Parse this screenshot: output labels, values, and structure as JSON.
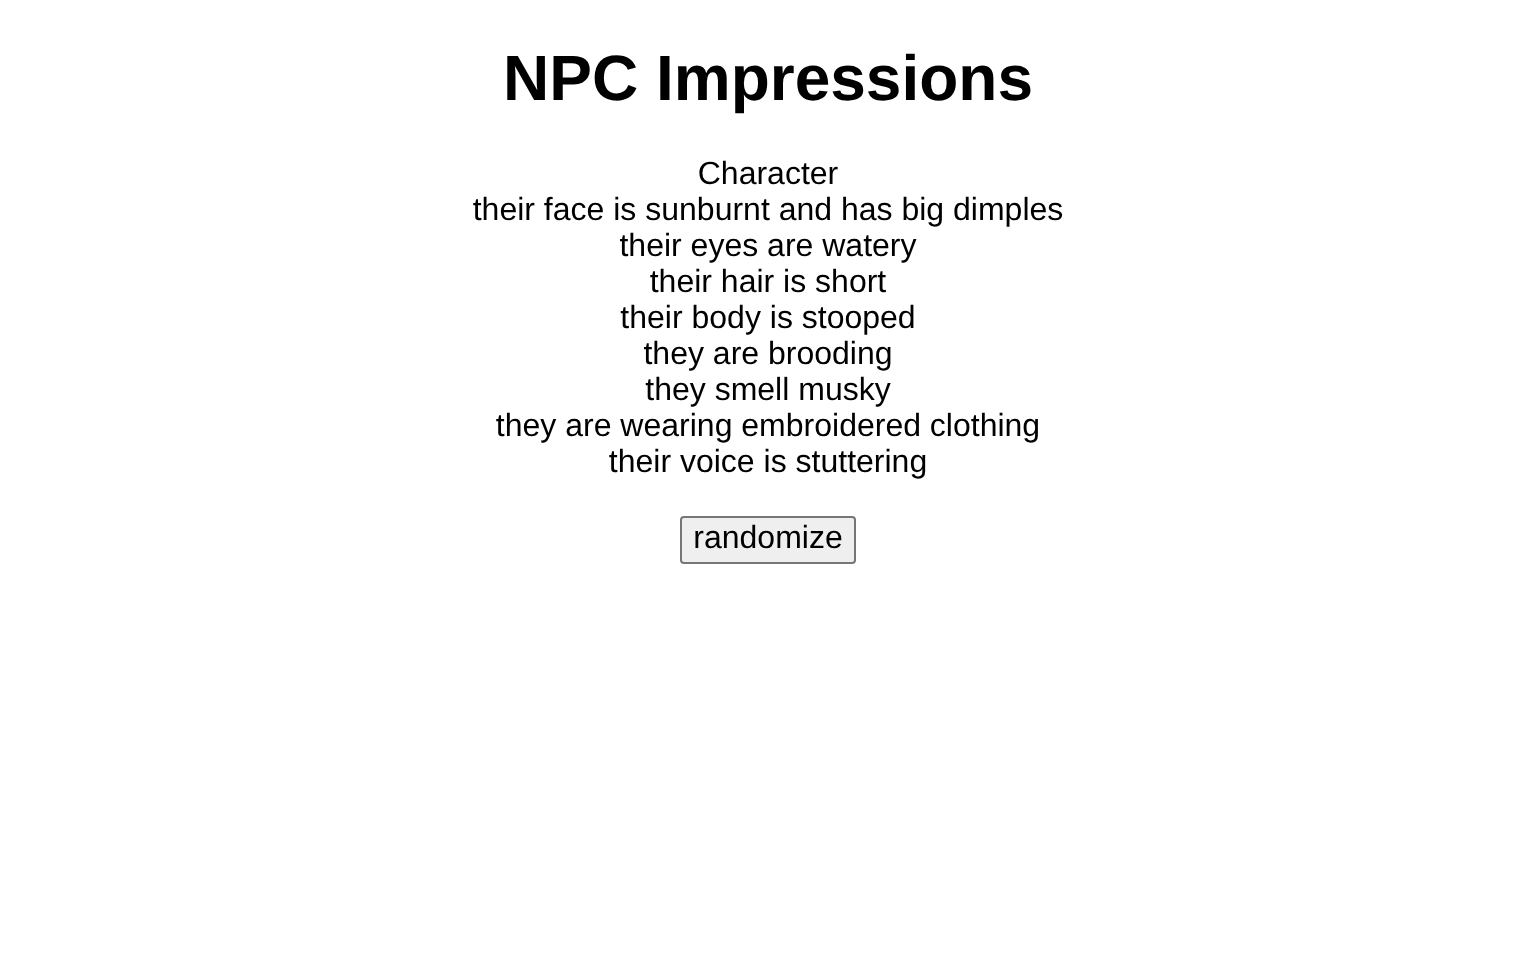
{
  "title": "NPC Impressions",
  "heading": "Character",
  "traits": [
    "their face is sunburnt and has big dimples",
    "their eyes are watery",
    "their hair is short",
    "their body is stooped",
    "they are brooding",
    "they smell musky",
    "they are wearing embroidered clothing",
    "their voice is stuttering"
  ],
  "button": "randomize"
}
